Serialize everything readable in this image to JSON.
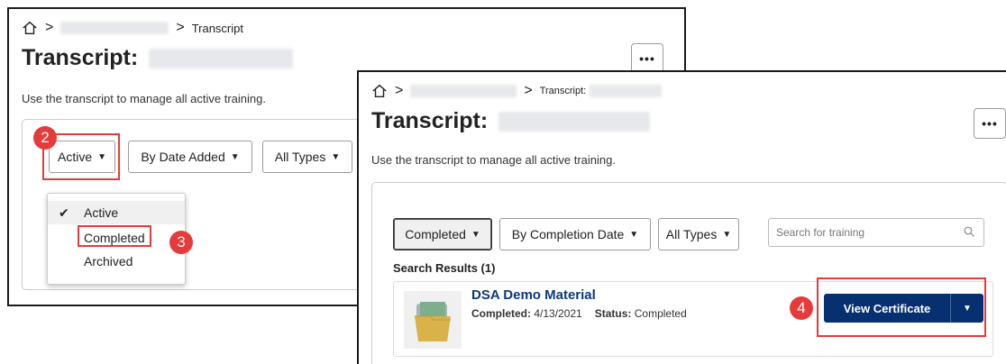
{
  "panel_front": {
    "breadcrumb_current": "Transcript",
    "title": "Transcript:",
    "description": "Use the transcript to manage all active training.",
    "more_label": "•••",
    "filters": {
      "status": "Active",
      "sort": "By Date Added",
      "type": "All Types"
    },
    "status_menu": [
      "Active",
      "Completed",
      "Archived"
    ],
    "callouts": [
      "2",
      "3"
    ]
  },
  "panel_back": {
    "breadcrumb_current": "Transcript:",
    "title": "Transcript:",
    "description": "Use the transcript to manage all active training.",
    "more_label": "•••",
    "filters": {
      "status": "Completed",
      "sort": "By Completion Date",
      "type": "All Types"
    },
    "search_placeholder": "Search for training",
    "results_label": "Search Results (1)",
    "item": {
      "title": "DSA Demo Material",
      "completed_label": "Completed:",
      "completed_date": "4/13/2021",
      "status_label": "Status:",
      "status_value": "Completed"
    },
    "certificate_button": "View Certificate",
    "callout": "4"
  },
  "colors": {
    "callout": "#e53b3b",
    "primary_button": "#073070",
    "link_title": "#0b3a78"
  },
  "icons": [
    "home-icon",
    "chevron-right-icon",
    "caret-down-icon",
    "check-icon",
    "search-icon",
    "folder-thumbnail-icon"
  ]
}
